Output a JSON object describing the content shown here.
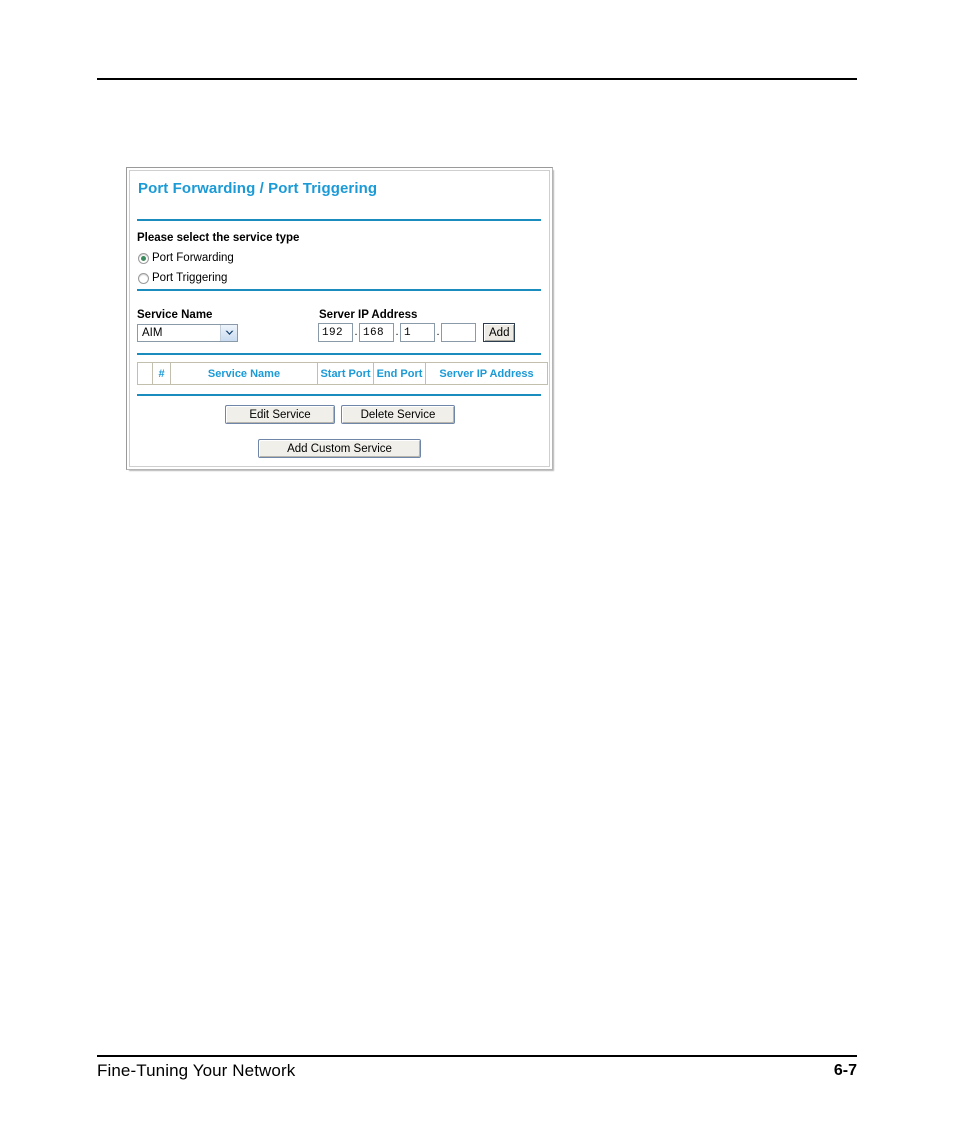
{
  "document": {
    "footer_left": "Fine-Tuning Your Network",
    "footer_page": "6-7"
  },
  "panel": {
    "title": "Port Forwarding / Port Triggering",
    "service_type": {
      "label": "Please select the service type",
      "options": [
        {
          "label": "Port Forwarding",
          "selected": true
        },
        {
          "label": "Port Triggering",
          "selected": false
        }
      ]
    },
    "service_name": {
      "label": "Service Name",
      "selected": "AIM"
    },
    "server_ip": {
      "label": "Server IP Address",
      "octets": [
        "192",
        "168",
        "1",
        ""
      ],
      "separator": ".",
      "add_label": "Add"
    },
    "table": {
      "columns": [
        "",
        "#",
        "Service Name",
        "Start Port",
        "End Port",
        "Server IP Address"
      ],
      "rows": []
    },
    "actions": {
      "edit": "Edit Service",
      "delete": "Delete Service",
      "add_custom": "Add Custom Service"
    }
  },
  "colors": {
    "accent_blue": "#1b9ad6",
    "rule_blue": "#1b8cbe",
    "radio_dot": "#3c8a5e"
  }
}
